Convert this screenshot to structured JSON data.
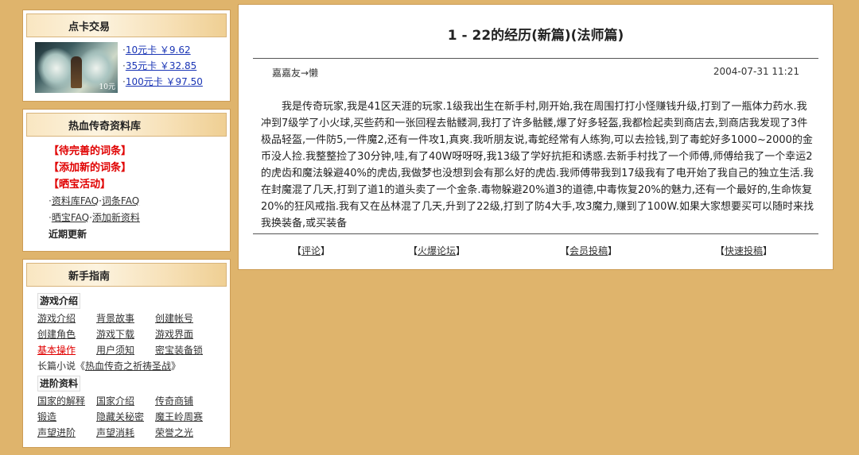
{
  "card": {
    "title": "点卡交易",
    "image_tag": "10元",
    "items": [
      "10元卡 ￥9.62",
      "35元卡 ￥32.85",
      "100元卡 ￥97.50"
    ]
  },
  "wiki": {
    "title": "热血传奇资料库",
    "red_links": [
      "【待完善的词条】",
      "【添加新的词条】",
      "【晒宝活动】"
    ],
    "faq1": "资料库FAQ",
    "faq1_sep": "·",
    "faq2": "词条FAQ",
    "faq3": "晒宝FAQ",
    "faq4": "添加新资料",
    "recent": "近期更新"
  },
  "guide": {
    "title": "新手指南",
    "section1": "游戏介绍",
    "grid1": [
      {
        "label": "游戏介绍",
        "hot": false
      },
      {
        "label": "背景故事",
        "hot": false
      },
      {
        "label": "创建帐号",
        "hot": false
      },
      {
        "label": "创建角色",
        "hot": false
      },
      {
        "label": "游戏下载",
        "hot": false
      },
      {
        "label": "游戏界面",
        "hot": false
      },
      {
        "label": "基本操作",
        "hot": true
      },
      {
        "label": "用户须知",
        "hot": false
      },
      {
        "label": "密宝装备锁",
        "hot": false
      }
    ],
    "novel_prefix": "长篇小说《",
    "novel_link": "热血传奇之祈祷圣战",
    "novel_suffix": "》",
    "section2": "进阶资料",
    "grid2": [
      {
        "label": "国家的解释",
        "hot": false
      },
      {
        "label": "国家介绍",
        "hot": false
      },
      {
        "label": "传奇商铺",
        "hot": false
      },
      {
        "label": "锻造",
        "hot": false
      },
      {
        "label": "隐藏关秘密",
        "hot": false
      },
      {
        "label": "魔王岭周赛",
        "hot": false
      },
      {
        "label": "声望进阶",
        "hot": false
      },
      {
        "label": "声望消耗",
        "hot": false
      },
      {
        "label": "荣誉之光",
        "hot": false
      }
    ]
  },
  "article": {
    "title": "1 - 22的经历(新篇)(法师篇)",
    "author": "嘉嘉友→懒",
    "date": "2004-07-31 11:21",
    "body": "我是传奇玩家,我是41区天涯的玩家.1级我出生在新手村,刚开始,我在周围打打小怪赚钱升级,打到了一瓶体力药水.我冲到7级学了小火球,买些药和一张回程去骷髅洞,我打了许多骷髅,爆了好多轻盔,我都检起卖到商店去,到商店我发现了3件极品轻盔,一件防5,一件魔2,还有一件攻1,真爽.我听朋友说,毒蛇经常有人练狗,可以去捡钱,到了毒蛇好多1000~2000的金币没人捡.我整整捡了30分钟,哇,有了40W呀呀呀,我13级了学好抗拒和诱惑.去新手村找了一个师傅,师傅给我了一个幸运2的虎齿和魔法躲避40%的虎齿,我做梦也没想到会有那么好的虎齿.我师傅带我到17级我有了电开始了我自己的独立生活.我在封魔混了几天,打到了道1的道头卖了一个金条.毒物躲避20%道3的道德,中毒恢复20%的魅力,还有一个最好的,生命恢复20%的狂风戒指.我有又在丛林混了几天,升到了22级,打到了防4大手,攻3魔力,赚到了100W.如果大家想要买可以随时来找我换装备,或买装备",
    "actions": [
      "评论",
      "火爆论坛",
      "会员投稿",
      "快速投稿"
    ]
  },
  "colors": {
    "background": "#dfb46c",
    "link": "#1a35b5",
    "hot": "#e00000"
  }
}
